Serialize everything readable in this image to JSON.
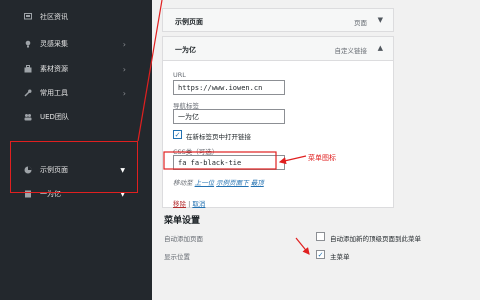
{
  "sidebar": {
    "items": [
      {
        "icon": "chat-icon",
        "label": "社区资讯",
        "arrow": ""
      },
      {
        "icon": "lightbulb-icon",
        "label": "灵感采集",
        "arrow": "›"
      },
      {
        "icon": "briefcase-icon",
        "label": "素材资源",
        "arrow": "›"
      },
      {
        "icon": "wrench-icon",
        "label": "常用工具",
        "arrow": "›"
      },
      {
        "icon": "users-icon",
        "label": "UED团队",
        "arrow": ""
      },
      {
        "icon": "pie-chart-icon",
        "label": "示例页面",
        "arrow": "▼"
      },
      {
        "icon": "book-icon",
        "label": "一为亿",
        "arrow": "▼"
      }
    ]
  },
  "menu_panel_1": {
    "title": "示例页面",
    "type": "页面",
    "caret": "▼"
  },
  "menu_panel_2": {
    "title": "一为亿",
    "type": "自定义链接",
    "caret": "▲",
    "url_label": "URL",
    "url_value": "https://www.iowen.cn",
    "nav_label_label": "导航标签",
    "nav_label_value": "一为亿",
    "new_tab_label": "在新标签页中打开链接",
    "css_label": "CSS类（可选）",
    "css_value": "fa fa-black-tie",
    "move_prefix": "移动至",
    "move_up": "上一位",
    "move_under": "示例页面下",
    "move_top": "最顶",
    "remove": "移除",
    "separator": "|",
    "cancel": "取消"
  },
  "annotation": "菜单图标",
  "menu_settings": {
    "title": "菜单设置",
    "auto_add_label": "自动添加页面",
    "auto_add_option": "自动添加新的顶级页面到此菜单",
    "display_label": "显示位置",
    "display_option": "主菜单"
  },
  "colors": {
    "sidebar_bg": "#23282d",
    "accent": "#2271b1",
    "annotation_red": "#e02020"
  }
}
